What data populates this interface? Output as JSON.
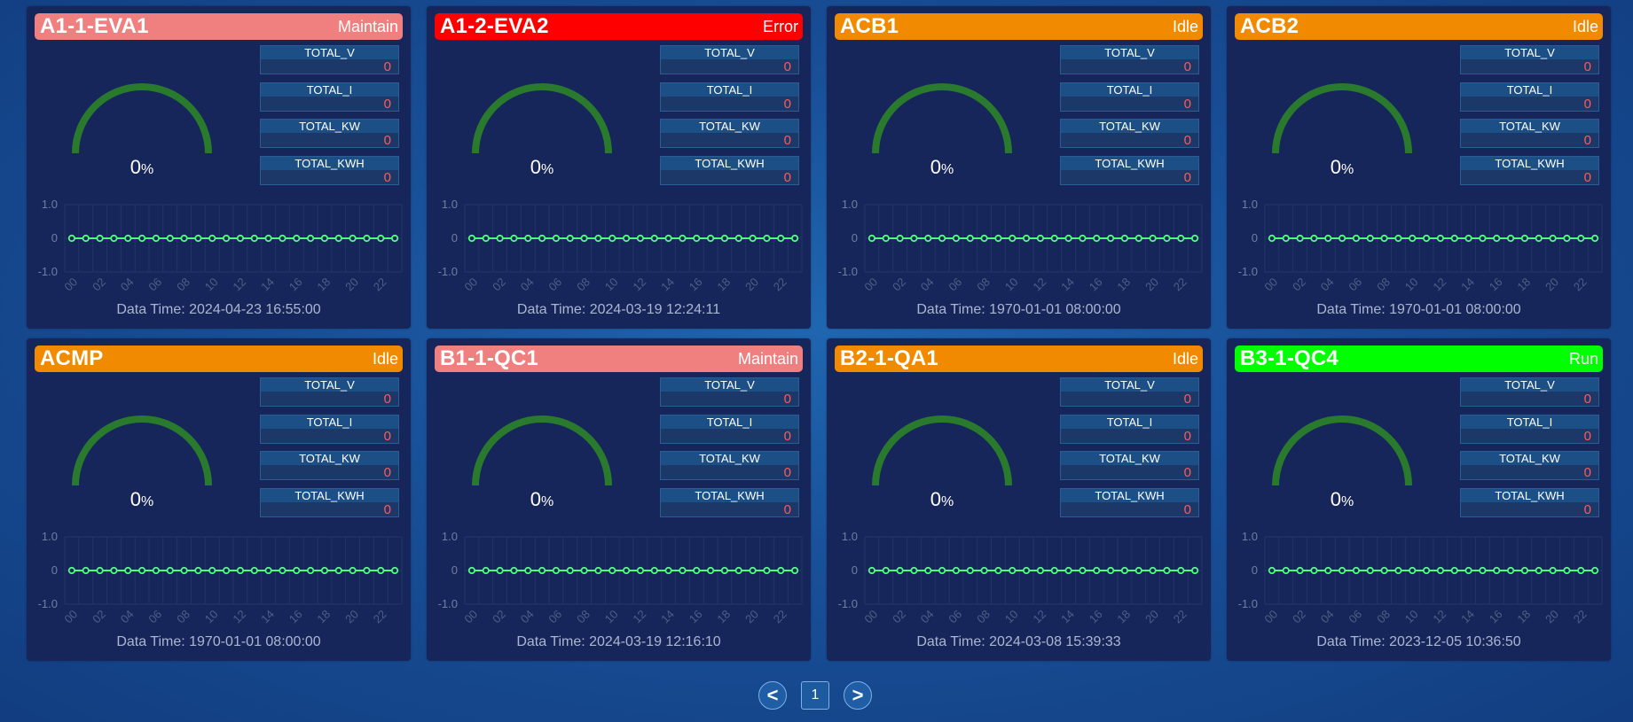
{
  "colors": {
    "Maintain": "#f08080",
    "Error": "#ff0000",
    "Idle": "#f28a00",
    "Run": "#00ff00",
    "gauge": "#2a7a2e",
    "line": "#4cff7a",
    "value": "#ff5a5a"
  },
  "metric_labels": [
    "TOTAL_V",
    "TOTAL_I",
    "TOTAL_KW",
    "TOTAL_KWH"
  ],
  "chart_axis": {
    "y_ticks": [
      "1.0",
      "0",
      "-1.0"
    ],
    "x_ticks": [
      "00",
      "02",
      "04",
      "06",
      "08",
      "10",
      "12",
      "14",
      "16",
      "18",
      "20",
      "22"
    ],
    "ylim": [
      -1,
      1
    ]
  },
  "cards": [
    {
      "name": "A1-1-EVA1",
      "status": "Maintain",
      "gauge": "0",
      "gauge_unit": "%",
      "values": [
        "0",
        "0",
        "0",
        "0"
      ],
      "data_time": "Data Time: 2024-04-23 16:55:00"
    },
    {
      "name": "A1-2-EVA2",
      "status": "Error",
      "gauge": "0",
      "gauge_unit": "%",
      "values": [
        "0",
        "0",
        "0",
        "0"
      ],
      "data_time": "Data Time: 2024-03-19 12:24:11"
    },
    {
      "name": "ACB1",
      "status": "Idle",
      "gauge": "0",
      "gauge_unit": "%",
      "values": [
        "0",
        "0",
        "0",
        "0"
      ],
      "data_time": "Data Time: 1970-01-01 08:00:00"
    },
    {
      "name": "ACB2",
      "status": "Idle",
      "gauge": "0",
      "gauge_unit": "%",
      "values": [
        "0",
        "0",
        "0",
        "0"
      ],
      "data_time": "Data Time: 1970-01-01 08:00:00"
    },
    {
      "name": "ACMP",
      "status": "Idle",
      "gauge": "0",
      "gauge_unit": "%",
      "values": [
        "0",
        "0",
        "0",
        "0"
      ],
      "data_time": "Data Time: 1970-01-01 08:00:00"
    },
    {
      "name": "B1-1-QC1",
      "status": "Maintain",
      "gauge": "0",
      "gauge_unit": "%",
      "values": [
        "0",
        "0",
        "0",
        "0"
      ],
      "data_time": "Data Time: 2024-03-19 12:16:10"
    },
    {
      "name": "B2-1-QA1",
      "status": "Idle",
      "gauge": "0",
      "gauge_unit": "%",
      "values": [
        "0",
        "0",
        "0",
        "0"
      ],
      "data_time": "Data Time: 2024-03-08 15:39:33"
    },
    {
      "name": "B3-1-QC4",
      "status": "Run",
      "gauge": "0",
      "gauge_unit": "%",
      "values": [
        "0",
        "0",
        "0",
        "0"
      ],
      "data_time": "Data Time: 2023-12-05 10:36:50"
    }
  ],
  "chart_data": {
    "type": "line",
    "x": [
      "00",
      "01",
      "02",
      "03",
      "04",
      "05",
      "06",
      "07",
      "08",
      "09",
      "10",
      "11",
      "12",
      "13",
      "14",
      "15",
      "16",
      "17",
      "18",
      "19",
      "20",
      "21",
      "22",
      "23"
    ],
    "series": [
      {
        "values": [
          0,
          0,
          0,
          0,
          0,
          0,
          0,
          0,
          0,
          0,
          0,
          0,
          0,
          0,
          0,
          0,
          0,
          0,
          0,
          0,
          0,
          0,
          0,
          0
        ]
      }
    ],
    "ylim": [
      -1,
      1
    ],
    "y_ticks": [
      1.0,
      0,
      -1.0
    ],
    "grid": true
  },
  "pager": {
    "prev": "<",
    "page": "1",
    "next": ">"
  }
}
